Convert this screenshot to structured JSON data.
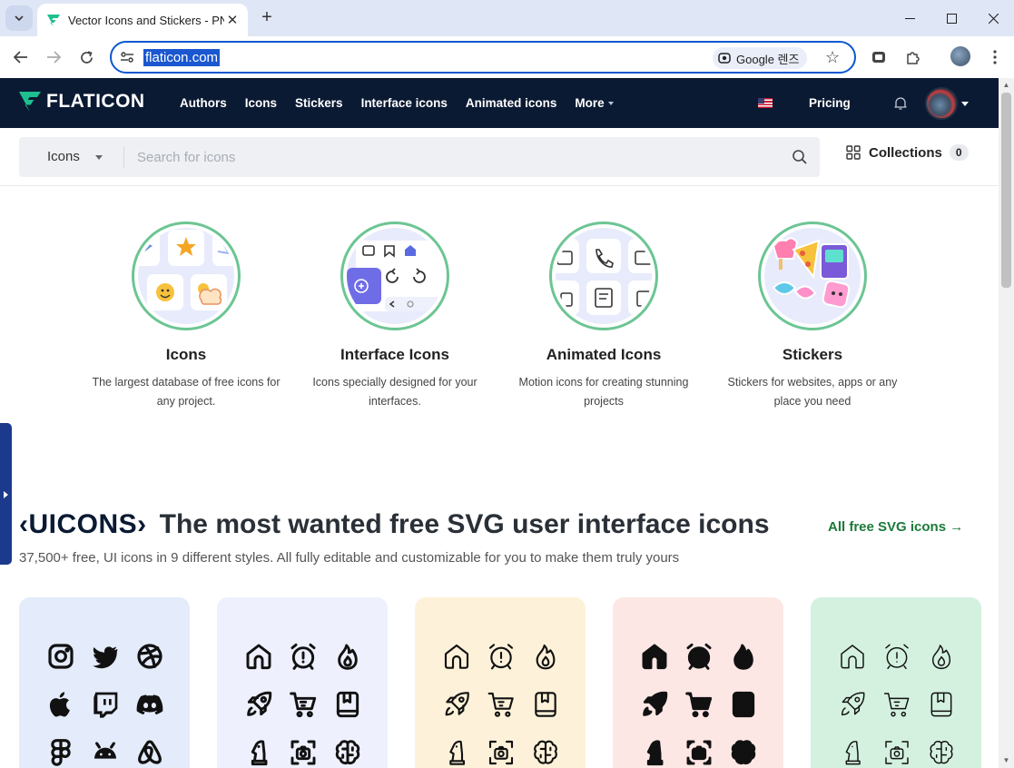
{
  "browser": {
    "tab_title": "Vector Icons and Stickers - PNG",
    "url": "flaticon.com",
    "lens_label": "Google 렌즈"
  },
  "header": {
    "brand": "FLATICON",
    "nav": [
      "Authors",
      "Icons",
      "Stickers",
      "Interface icons",
      "Animated icons",
      "More"
    ],
    "pricing": "Pricing"
  },
  "search": {
    "type": "Icons",
    "placeholder": "Search for icons",
    "collections_label": "Collections",
    "collections_count": "0"
  },
  "categories": [
    {
      "title": "Icons",
      "desc": "The largest database of free icons for any project."
    },
    {
      "title": "Interface Icons",
      "desc": "Icons specially designed for your interfaces."
    },
    {
      "title": "Animated Icons",
      "desc": "Motion icons for creating stunning projects"
    },
    {
      "title": "Stickers",
      "desc": "Stickers for websites, apps or any place you need"
    }
  ],
  "uicons": {
    "logo": "‹UICONS›",
    "title": "The most wanted free SVG user interface icons",
    "subtitle": "37,500+ free, UI icons in 9 different styles. All fully editable and customizable for you to make them truly yours",
    "all_link": "All free SVG icons →"
  },
  "cards": [
    {
      "bg": "#e4ebfb",
      "icons": [
        "instagram-icon",
        "twitter-icon",
        "dribbble-icon",
        "apple-icon",
        "twitch-icon",
        "discord-icon",
        "figma-icon",
        "android-icon",
        "airbnb-icon"
      ]
    },
    {
      "bg": "#eef0fd",
      "icons": [
        "home-icon",
        "alarm-icon",
        "fire-icon",
        "rocket-icon",
        "cart-icon",
        "book-icon",
        "chess-icon",
        "camera-icon",
        "brain-icon"
      ]
    },
    {
      "bg": "#fdf2d9",
      "icons": [
        "home-icon",
        "alarm-icon",
        "fire-icon",
        "rocket-icon",
        "cart-icon",
        "book-icon",
        "chess-icon",
        "camera-icon",
        "brain-icon"
      ]
    },
    {
      "bg": "#fde7e5",
      "icons": [
        "home-icon",
        "alarm-icon",
        "fire-icon",
        "rocket-icon",
        "cart-icon",
        "book-icon",
        "chess-icon",
        "camera-icon",
        "brain-icon"
      ]
    },
    {
      "bg": "#d4f1e0",
      "icons": [
        "home-icon",
        "alarm-icon",
        "fire-icon",
        "rocket-icon",
        "cart-icon",
        "book-icon",
        "chess-icon",
        "camera-icon",
        "brain-icon"
      ]
    }
  ],
  "colors": {
    "header_bg": "#0b1a33",
    "accent_green": "#1b7a3a",
    "omnibox_border": "#0b57d0"
  }
}
